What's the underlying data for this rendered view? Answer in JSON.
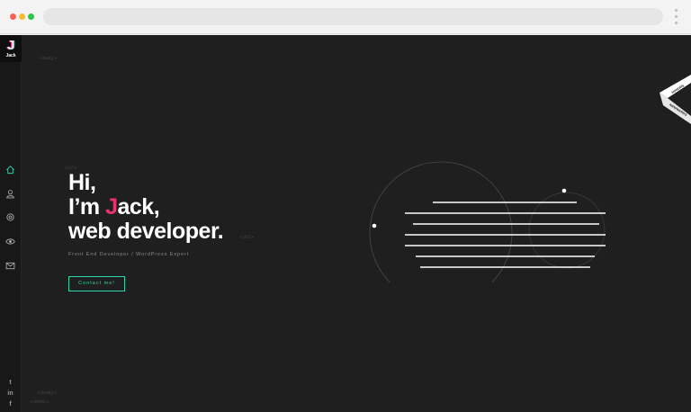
{
  "brand": {
    "letter": "J",
    "name": "Jack"
  },
  "nav": [
    {
      "icon": "home-icon",
      "label": "Home"
    },
    {
      "icon": "user-icon",
      "label": "About"
    },
    {
      "icon": "settings-icon",
      "label": "Services"
    },
    {
      "icon": "eye-icon",
      "label": "Portfolio"
    },
    {
      "icon": "mail-icon",
      "label": "Contact"
    }
  ],
  "social": {
    "twitter": "t",
    "linkedin": "in",
    "facebook": "f"
  },
  "code_tags": {
    "body_open": "<body>",
    "h1_open": "<h1>",
    "h1_close": "</h1>",
    "body_close": "</body>",
    "html_close": "</html>"
  },
  "hero": {
    "line1": "Hi,",
    "line2_prefix": "I’m ",
    "line2_accent": "J",
    "line2_rest": "ack,",
    "line3": "web developer."
  },
  "subtitle": "Front End Developer / WordPress Expert",
  "cta_label": "Contact me!",
  "ribbon": {
    "top": "HONORS",
    "bottom": "AWWWARDS"
  },
  "colors": {
    "accent": "#e8336d",
    "teal": "#31d3a8",
    "background": "#1f1f1f"
  }
}
